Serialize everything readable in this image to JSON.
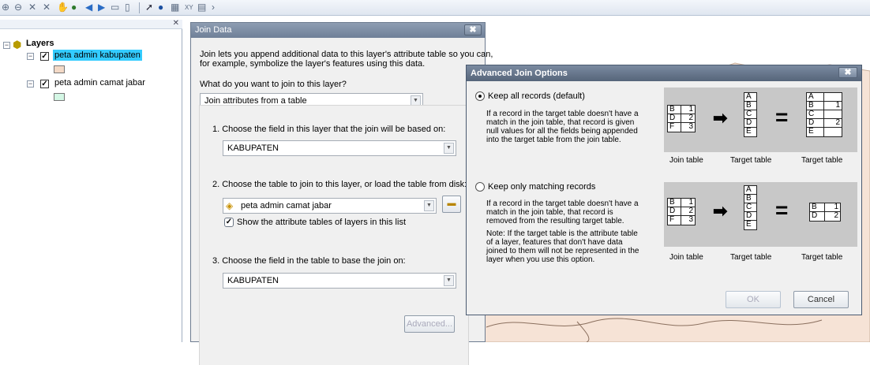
{
  "toc": {
    "root_label": "Layers",
    "layers": [
      {
        "name": "peta admin kabupaten",
        "checked": true,
        "selected": true,
        "swatch_color": "#f3d9c6"
      },
      {
        "name": "peta admin camat jabar",
        "checked": true,
        "selected": false,
        "swatch_color": "#d4f7e5"
      }
    ]
  },
  "join_dialog": {
    "title": "Join Data",
    "intro_line1": "Join lets you append additional data to this layer's attribute table so you can,",
    "intro_line2": "for example, symbolize the layer's features using this data.",
    "question": "What do you want to join to this layer?",
    "join_type": "Join attributes from a table",
    "step1": "1. Choose the field in this layer that the join will be based on:",
    "step1_value": "KABUPATEN",
    "step2": "2. Choose the table to join to this layer, or load the table from disk:",
    "step2_value": "peta admin camat jabar",
    "show_tables_label": "Show the attribute tables of layers in this list",
    "step3": "3. Choose the field in the table to base the join on:",
    "step3_value": "KABUPATEN",
    "advanced_label": "Advanced..."
  },
  "advanced_dialog": {
    "title": "Advanced Join Options",
    "option1_label": "Keep all records (default)",
    "option1_selected": true,
    "option1_desc": [
      "If a record in the target table doesn't have a",
      "match in the join table, that record is given",
      "null values for all the fields being appended",
      "into the target table from the join table."
    ],
    "option2_label": "Keep only matching records",
    "option2_selected": false,
    "option2_desc": [
      "If a record in the target table doesn't have a",
      "match in the join table, that record is",
      "removed from the resulting target table."
    ],
    "option2_note": [
      "Note: If the target table is the attribute table",
      "of a layer, features that don't have data",
      "joined to them will not be represented in the",
      "layer when you use this option."
    ],
    "caption_join": "Join table",
    "caption_target": "Target table",
    "caption_result": "Target table",
    "join_table": [
      [
        "B",
        "1"
      ],
      [
        "D",
        "2"
      ],
      [
        "F",
        "3"
      ]
    ],
    "target_table": [
      "A",
      "B",
      "C",
      "D",
      "E"
    ],
    "result1": [
      [
        "A",
        ""
      ],
      [
        "B",
        "1"
      ],
      [
        "C",
        ""
      ],
      [
        "D",
        "2"
      ],
      [
        "E",
        ""
      ]
    ],
    "result2": [
      [
        "B",
        "1"
      ],
      [
        "D",
        "2"
      ]
    ],
    "ok_label": "OK",
    "cancel_label": "Cancel"
  }
}
